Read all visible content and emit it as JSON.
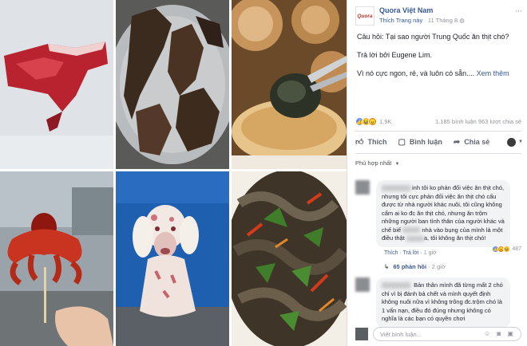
{
  "post": {
    "page_name": "Quora Việt Nam",
    "avatar_text": "Quora",
    "like_link": "Thích Trang này",
    "date": "11 Tháng 8",
    "question": "Câu hỏi: Tại sao người Trung Quốc ăn thịt chó?",
    "answered_by": "Trả lời bởi Eugene Lim.",
    "answer": "Vì nó cực ngon, rẻ, và luôn có sẵn....",
    "see_more": "Xem thêm"
  },
  "stats": {
    "reaction_count": "1,9K",
    "comments": "1.185 bình luận",
    "shares": "963 lượt chia sẻ"
  },
  "actions": {
    "like": "Thích",
    "comment": "Bình luận",
    "share": "Chia sẻ"
  },
  "sort_label": "Phù hợp nhất",
  "comments": [
    {
      "visible_name_fragment": "inh",
      "text_a": "tôi ko phản đối việc ăn thịt chó, nhưng tôi cực phản đối việc ăn thịt chó cấu được từ nhà người khác nuôi, tôi cũng không cấm ai ko đc ăn thịt chó, nhưng ăn trộm những người ban tình thân của người khác và chế biế",
      "text_b": "nhà vào bụng của mình là một điều thật",
      "text_c": "a, tôi không ăn thịt chó!",
      "like": "Thích",
      "reply": "Trả lời",
      "time": "1 giờ",
      "reaction_count": "487",
      "replies": "65 phản hồi",
      "replies_time": "2 giờ"
    },
    {
      "text": "Bản thân mình đã từng mất 2 chó chỉ vì bị đánh bả chết và mình quyết định không nuôi nữa vì không trông đc.trộm chó là 1 vấn nạn, điều đó đúng nhưng không có nghĩa là các bạn có quyền chơi"
    }
  ],
  "write_placeholder": "Viết bình luận..."
}
